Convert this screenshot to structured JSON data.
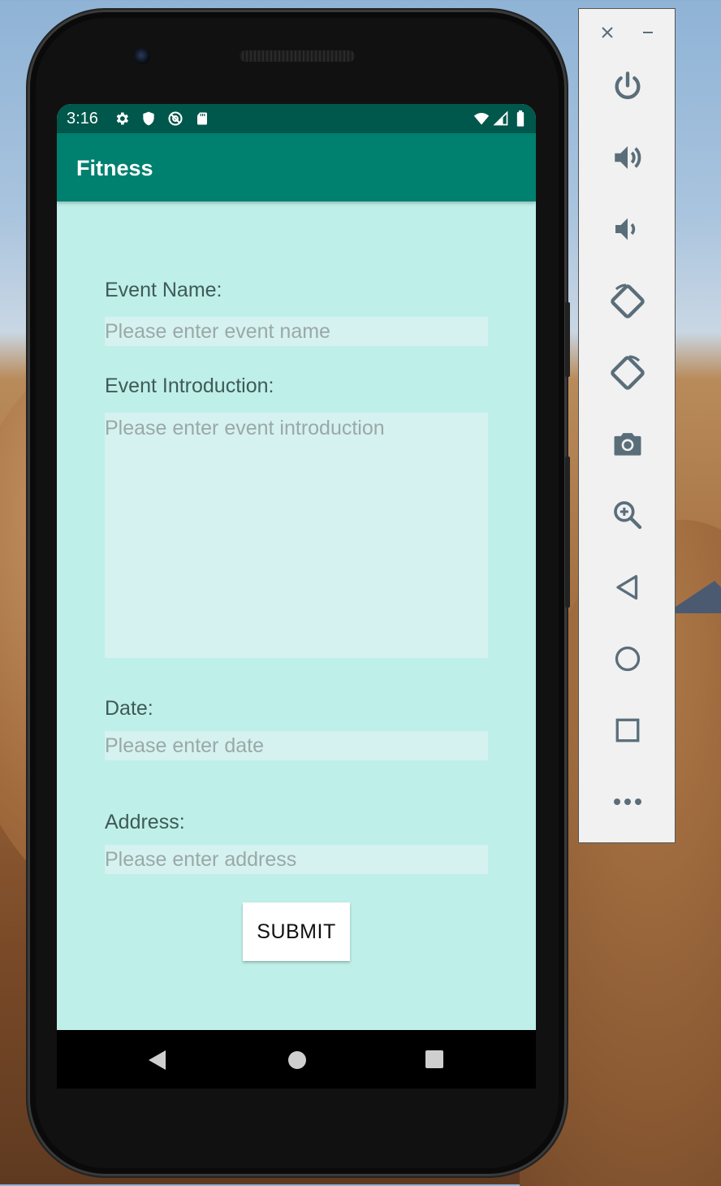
{
  "status_bar": {
    "time": "3:16",
    "left_icons": [
      "gear-icon",
      "shield-icon",
      "at-sign-icon",
      "sd-card-icon"
    ],
    "right_icons": [
      "wifi-icon",
      "cell-signal-icon",
      "battery-icon"
    ]
  },
  "app_bar": {
    "title": "Fitness"
  },
  "form": {
    "event_name_label": "Event Name:",
    "event_name_placeholder": "Please enter event name",
    "event_intro_label": "Event Introduction:",
    "event_intro_placeholder": "Please enter event introduction",
    "date_label": "Date:",
    "date_placeholder": "Please enter date",
    "address_label": "Address:",
    "address_placeholder": "Please enter address",
    "submit_label": "SUBMIT"
  },
  "nav_bar": {
    "buttons": [
      "back-icon",
      "home-icon",
      "recents-icon"
    ]
  },
  "emulator_toolbar": {
    "buttons": [
      "close-icon",
      "minimize-icon",
      "power-icon",
      "volume-up-icon",
      "volume-down-icon",
      "rotate-left-icon",
      "rotate-right-icon",
      "camera-icon",
      "zoom-icon",
      "back-icon",
      "home-icon",
      "overview-icon",
      "more-icon"
    ]
  },
  "colors": {
    "status_bar": "#00574b",
    "app_bar": "#00806f",
    "background": "#bfefe9",
    "input_fill": "#d5f2f0",
    "toolbar_icon": "#5a6e7a"
  }
}
